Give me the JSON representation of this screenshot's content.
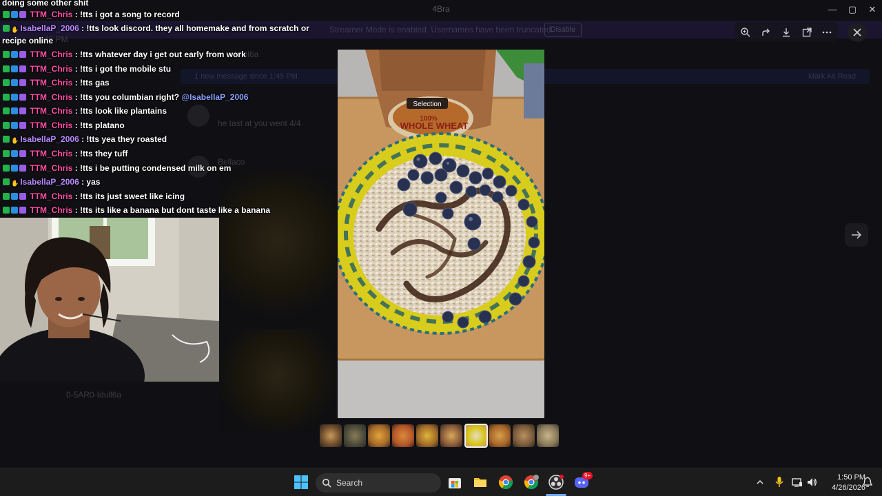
{
  "background_app": {
    "window_title": "4Bra",
    "streamer_banner": "Streamer Mode is enabled. Usernames have been truncated.",
    "streamer_banner_button": "Disable",
    "unread_text": "1 new message since 1:45 PM",
    "mark_read": "Mark As Read",
    "channel_text": "Iduil6a",
    "message_1": "he tast at you went 4/4",
    "author_2": "Bellaco",
    "channel_list_item": "0-5AR0-Idull6a",
    "timestamp_overlap": "45 PM"
  },
  "chat": {
    "lines": [
      {
        "user": "",
        "message": "doing some other shit",
        "badges": [],
        "user_color": ""
      },
      {
        "user": "TTM_Chris",
        "message": ": !tts i got a song to record",
        "badges": [
          "mod",
          "prime",
          "sub"
        ]
      },
      {
        "user": "IsabellaP_2006",
        "message": ": !tts look discord. they all homemake and from scratch or",
        "badges": [
          "mod",
          "hand"
        ]
      },
      {
        "user": "",
        "message": "recipe online",
        "badges": []
      },
      {
        "user": "TTM_Chris",
        "message": ": !tts whatever day i get out early from work",
        "badges": [
          "mod",
          "prime",
          "sub"
        ]
      },
      {
        "user": "TTM_Chris",
        "message": ": !tts i got the mobile stu",
        "badges": [
          "mod",
          "prime",
          "sub"
        ]
      },
      {
        "user": "TTM_Chris",
        "message": ": !tts gas",
        "badges": [
          "mod",
          "prime",
          "sub"
        ]
      },
      {
        "user": "TTM_Chris",
        "message": ": !tts you columbian right?",
        "mention": "@IsabellaP_2006",
        "badges": [
          "mod",
          "prime",
          "sub"
        ]
      },
      {
        "user": "TTM_Chris",
        "message": ": !tts look like plantains",
        "badges": [
          "mod",
          "prime",
          "sub"
        ]
      },
      {
        "user": "TTM_Chris",
        "message": ": !tts platano",
        "badges": [
          "mod",
          "prime",
          "sub"
        ]
      },
      {
        "user": "IsabellaP_2006",
        "message": ": !tts yea they roasted",
        "badges": [
          "mod",
          "hand"
        ]
      },
      {
        "user": "TTM_Chris",
        "message": ": !tts they tuff",
        "badges": [
          "mod",
          "prime",
          "sub"
        ]
      },
      {
        "user": "TTM_Chris",
        "message": ": !tts i be putting condensed milk on em",
        "badges": [
          "mod",
          "prime",
          "sub"
        ]
      },
      {
        "user": "IsabellaP_2006",
        "message": ": yas",
        "badges": [
          "mod",
          "hand"
        ]
      },
      {
        "user": "TTM_Chris",
        "message": ": !tts its just sweet like icing",
        "badges": [
          "mod",
          "prime",
          "sub"
        ]
      },
      {
        "user": "TTM_Chris",
        "message": ": !tts its like a banana but dont taste like a banana",
        "badges": [
          "mod",
          "prime",
          "sub"
        ]
      }
    ]
  },
  "image_viewer": {
    "bread_brand": "Selection",
    "bread_label_1": "100%",
    "bread_label_2": "WHOLE WHEAT",
    "thumbnail_count": 10,
    "active_thumbnail": 7
  },
  "taskbar": {
    "search_label": "Search",
    "time": "1:50 PM",
    "date": "4/26/2026",
    "discord_badge": "9+"
  }
}
